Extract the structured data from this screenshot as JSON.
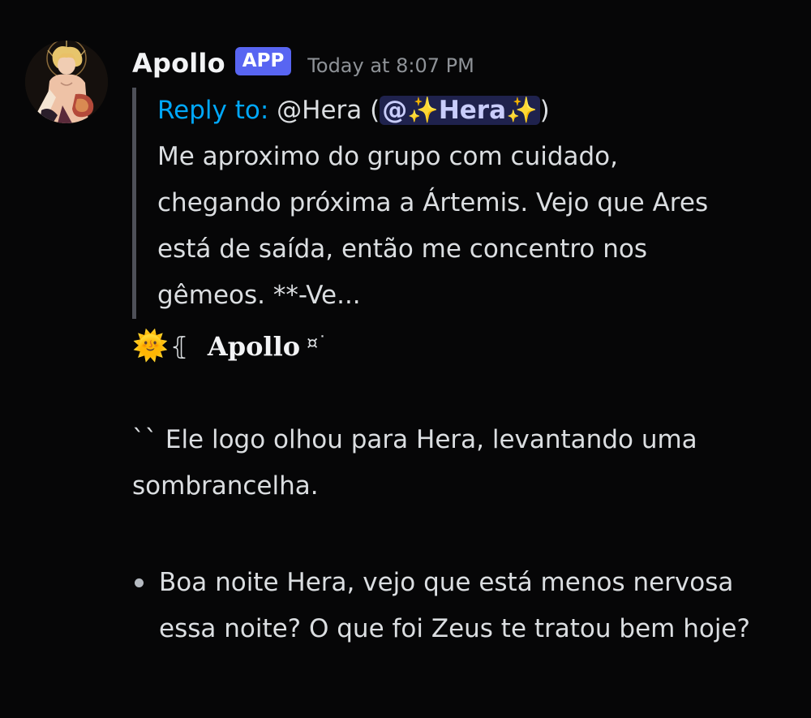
{
  "message": {
    "author": "Apollo",
    "badge": "APP",
    "timestamp": "Today at 8:07 PM",
    "avatar_icon": "apollo-avatar",
    "quote": {
      "reply_label": "Reply to:",
      "reply_handle": " @Hera (",
      "mention": "@✨Hera✨",
      "reply_close": ")",
      "lines": [
        "Me aproximo do grupo com cuidado,",
        "chegando próxima a Ártemis. Vejo que Ares",
        "está de saída, então me concentro nos",
        "gêmeos.  **-Ve..."
      ]
    },
    "signature": {
      "emoji": "🌞",
      "bracket": "⦃",
      "name": "Apollo",
      "symbol": "¤˙"
    },
    "paragraph": "`` Ele logo olhou para Hera, levantando uma sombrancelha.",
    "bullet": "Boa noite Hera, vejo que está menos nervosa essa noite? O que foi Zeus te tratou bem hoje?"
  },
  "colors": {
    "background": "#060607",
    "text": "#dbdee1",
    "username": "#f2f3f5",
    "badge": "#5865f2",
    "link": "#00a8fc",
    "mention_bg": "#3b4089",
    "quote_bar": "#4e5058",
    "timestamp": "#8e9297"
  }
}
